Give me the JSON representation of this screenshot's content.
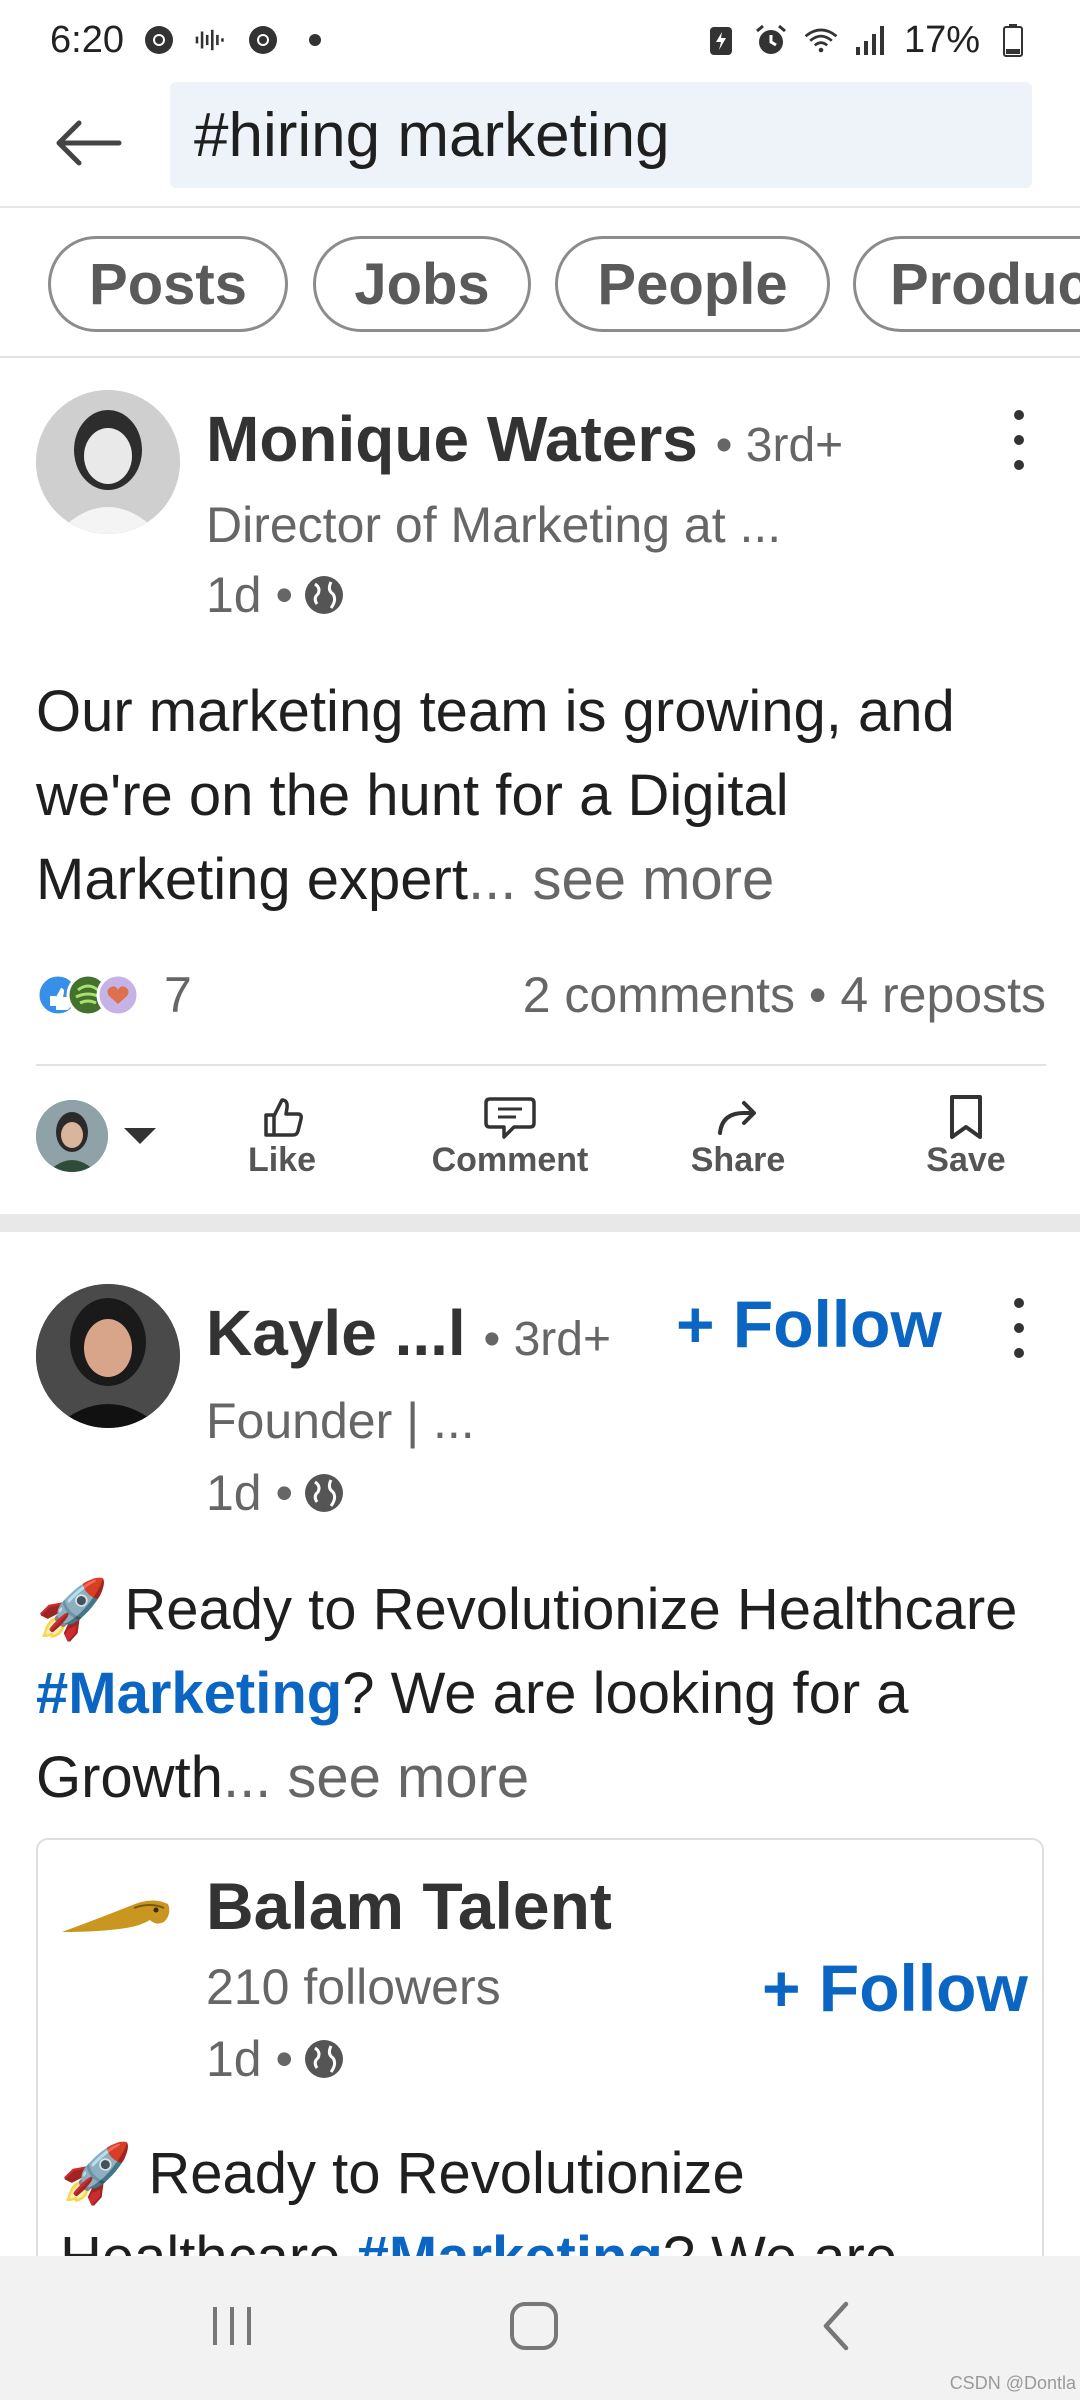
{
  "status_bar": {
    "time": "6:20",
    "battery": "17%",
    "icons": [
      "chrome-icon",
      "audio-icon",
      "chrome-icon",
      "dot-icon",
      "battery-saver-icon",
      "alarm-icon",
      "wifi-icon",
      "signal-icon",
      "battery-icon"
    ]
  },
  "search": {
    "query": "#hiring marketing"
  },
  "filters": [
    "Posts",
    "Jobs",
    "People",
    "Produc"
  ],
  "posts": [
    {
      "author": "Monique Waters",
      "degree": "• 3rd+",
      "headline": "Director of Marketing at ...",
      "time": "1d •",
      "body_text": "Our marketing team is growing, and we're on the hunt for a Digital Marketing expert",
      "ellipsis": "...",
      "see_more": " see more",
      "reactions_count": "7",
      "stats": "2 comments • 4 reposts",
      "actions": {
        "like": "Like",
        "comment": "Comment",
        "share": "Share",
        "save": "Save"
      }
    },
    {
      "author": "Kayle ...l",
      "degree": "• 3rd+",
      "follow": "+ Follow",
      "headline": "Founder | ...",
      "time": "1d •",
      "emoji": "🚀",
      "body_pre": " Ready to Revolutionize Healthcare ",
      "hashtag": "#Marketing",
      "body_post": "? We are looking for a Growth",
      "ellipsis": "...",
      "see_more": " see more",
      "shared": {
        "company": "Balam Talent",
        "followers": "210 followers",
        "time": "1d •",
        "follow": "+ Follow",
        "emoji": "🚀",
        "body_pre": " Ready to Revolutionize Healthcare ",
        "hashtag": "#Marketing",
        "body_post": "? We are"
      }
    }
  ],
  "watermark": "CSDN @Dontla",
  "colors": {
    "link": "#0a66c2",
    "search_bg": "#edf3f8",
    "divider": "#e8e8e8"
  }
}
